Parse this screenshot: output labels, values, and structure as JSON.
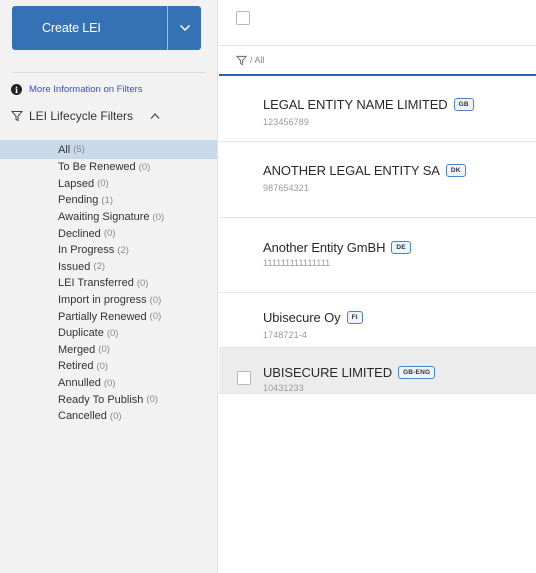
{
  "sidebar": {
    "create_button_label": "Create LEI",
    "more_info_link": "More Information on Filters",
    "lifecycle_label": "LEI Lifecycle Filters",
    "filters": [
      {
        "label": "All",
        "count": "(5)"
      },
      {
        "label": "To Be Renewed",
        "count": "(0)"
      },
      {
        "label": "Lapsed",
        "count": "(0)"
      },
      {
        "label": "Pending",
        "count": "(1)"
      },
      {
        "label": "Awaiting Signature",
        "count": "(0)"
      },
      {
        "label": "Declined",
        "count": "(0)"
      },
      {
        "label": "In Progress",
        "count": "(2)"
      },
      {
        "label": "Issued",
        "count": "(2)"
      },
      {
        "label": "LEI Transferred",
        "count": "(0)"
      },
      {
        "label": "Import in progress",
        "count": "(0)"
      },
      {
        "label": "Partially Renewed",
        "count": "(0)"
      },
      {
        "label": "Duplicate",
        "count": "(0)"
      },
      {
        "label": "Merged",
        "count": "(0)"
      },
      {
        "label": "Retired",
        "count": "(0)"
      },
      {
        "label": "Annulled",
        "count": "(0)"
      },
      {
        "label": "Ready To Publish",
        "count": "(0)"
      },
      {
        "label": "Cancelled",
        "count": "(0)"
      }
    ]
  },
  "main": {
    "breadcrumb": "/ All",
    "entities": [
      {
        "name": "LEGAL ENTITY NAME LIMITED",
        "country": "GB",
        "code": "123456789"
      },
      {
        "name": "ANOTHER LEGAL ENTITY SA",
        "country": "DK",
        "code": "987654321"
      },
      {
        "name": "Another Entity GmBH",
        "country": "DE",
        "code": "111111111111111"
      },
      {
        "name": "Ubisecure Oy",
        "country": "FI",
        "code": "1748721-4"
      },
      {
        "name": "UBISECURE LIMITED",
        "country": "GB-ENG",
        "code": "10431233"
      }
    ]
  },
  "colors": {
    "primary_button": "#3572b5",
    "active_filter": "#c8d9ea",
    "link": "#3a52c4",
    "badge_border": "#4a86c5"
  }
}
